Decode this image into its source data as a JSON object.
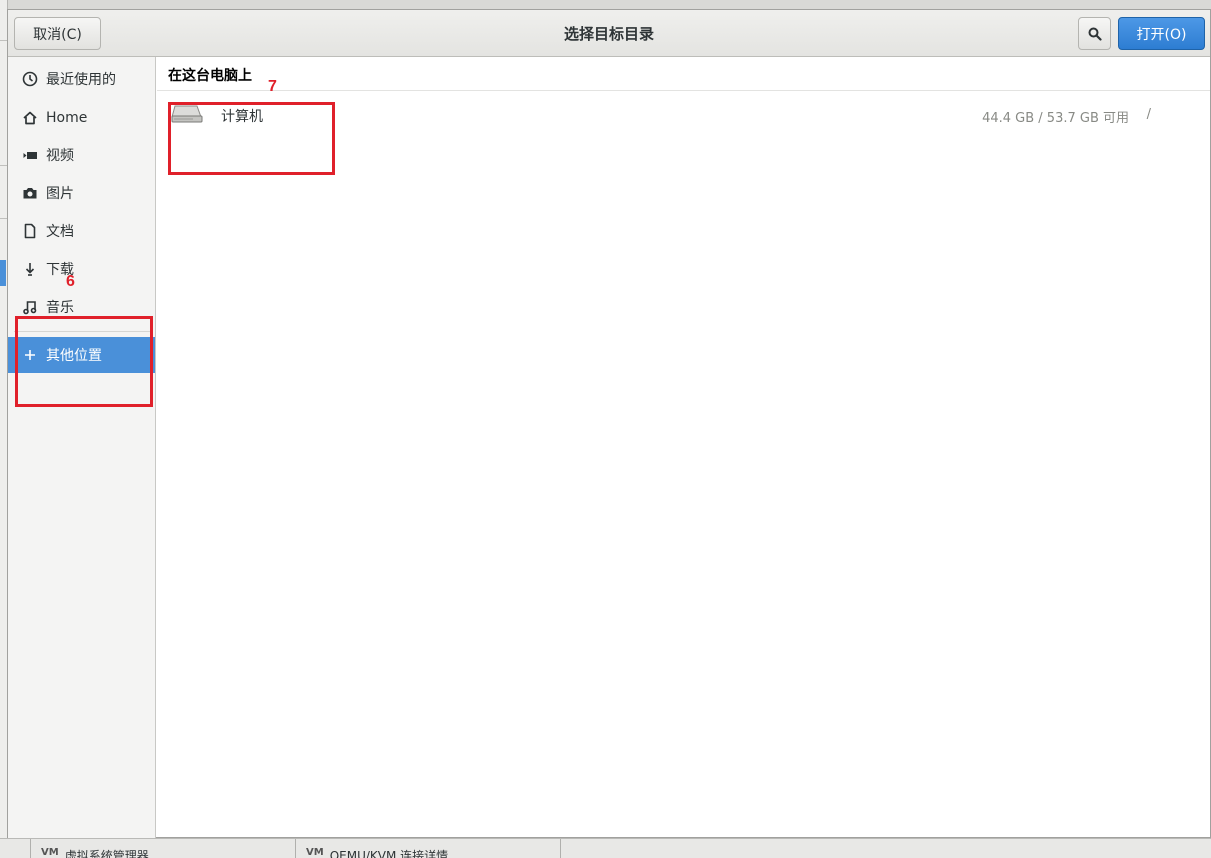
{
  "dialog": {
    "title": "选择目标目录",
    "cancel_label": "取消(C)",
    "open_label": "打开(O)"
  },
  "sidebar": {
    "items": [
      {
        "label": "最近使用的",
        "icon": "clock-icon"
      },
      {
        "label": "Home",
        "icon": "home-icon"
      },
      {
        "label": "视频",
        "icon": "video-icon"
      },
      {
        "label": "图片",
        "icon": "camera-icon"
      },
      {
        "label": "文档",
        "icon": "document-icon"
      },
      {
        "label": "下载",
        "icon": "download-icon"
      },
      {
        "label": "音乐",
        "icon": "music-icon"
      },
      {
        "label": "其他位置",
        "icon": "plus-icon"
      }
    ]
  },
  "main": {
    "section_title": "在这台电脑上",
    "rows": [
      {
        "name": "计算机",
        "size": "44.4 GB / 53.7 GB 可用",
        "path": "/",
        "icon": "drive-icon"
      }
    ]
  },
  "annotations": {
    "label_6": "6",
    "label_7": "7"
  },
  "taskbar": {
    "items": [
      {
        "label": "虚拟系统管理器"
      },
      {
        "label": "QEMU/KVM 连接详情"
      }
    ]
  },
  "colors": {
    "accent": "#4a90d9",
    "annotation": "#e0202a"
  }
}
